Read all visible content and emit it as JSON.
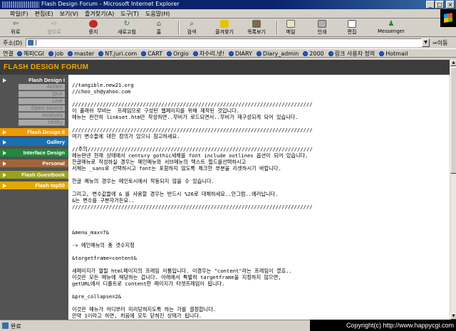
{
  "window": {
    "title": "Flash Design Forum  - Microsoft Internet Explorer",
    "minimize": "_",
    "maximize": "□",
    "close": "×"
  },
  "menu": [
    "파일(F)",
    "편집(E)",
    "보기(V)",
    "즐겨찾기(A)",
    "도구(T)",
    "도움말(H)"
  ],
  "toolbar": {
    "back": "뒤로",
    "forward": "앞으로",
    "stop": "중지",
    "refresh": "새로고침",
    "home": "홈",
    "search": "검색",
    "favorites": "즐겨찾기",
    "history": "목록보기",
    "mail": "메일",
    "print": "인쇄",
    "edit": "편집",
    "messenger": "Messenger"
  },
  "address": {
    "label": "주소(D)",
    "value": "|",
    "go": "이동"
  },
  "links": {
    "label": "연결",
    "items": [
      "해피CGI",
      "job",
      "master",
      "NT.juri.com",
      "CART",
      "Orgio",
      "차수리.넷!",
      "DIARY",
      "Diary_admin",
      "2000",
      "링크 사용자 정의",
      "Hotmail"
    ]
  },
  "site": {
    "logo": "FLASH DESIGN FORUM"
  },
  "sidebar": {
    "design1": "Flash Design I",
    "design1_subs": [
      "Action",
      "QnA",
      "Link",
      "Open source",
      "Analysis",
      "Utility"
    ],
    "design2": "Flash Design II",
    "gallery": "Gallery",
    "interface": "Interface Design",
    "personal": "Personal",
    "guestbook": "Flash Guestbook",
    "top50": "Flash top50"
  },
  "content": {
    "text": "//tangible.new21.org\n//choo_sh@yahoo.com\n\n//////////////////////////////////////////////////////////////////////////////\n이 플래쉬 무비는  프레임으로 구성된 웹페이지를 위해 제작된 것입니다.\n메뉴는 완전히 linkset.htm만 작성하면..무비가 로드되면서..무비가 재구성되게 되어 있습니다.\n\n//////////////////////////////////////////////////////////////////////////////\n여기 변수들에 대한 정의가 있으니 참고하세요.\n\n//주의/////////////////////////////////////////////////////////////////////////\n메뉴판넨 현재 상태에서 century gothic세체를 font include outlines 옵션이 되어 있습니다.\n한글메뉴로 작성하실 경우는 메인메뉴와 서브메뉴의 텍스트 필드를선택하시고\n서체는 _sans로 선택하시고 font는 포함하지 않도록 체크한 부분을 리셋하시기 바랍니다.\n\n한글 메뉴의 경우는 메인토시에서 작동되지 않을 수 있습니다.\n\n그리고, 변수값들에 & 를 사용할 경우는 반드시 %26로 대체하세요..안그럼..에러납니다.\n&는 변수를 구분자거든요..\n//////////////////////////////////////////////////////////////////////////////\n\n\n\n&menu_max=7&\n\n-> 메인메뉴의 총 갯수지정\n\n&targetframe=content&\n\n새페이지가 열릴 html페이지의 프레임 이름입니다. 이경우는 \"content\"라는 프레임이 겠죠..\n이것은 모든 메뉴에 해당하는 겁니다. 아래에서 특별히 targetframe을 지정하지 않으면,\ngetURL에서 디폴트로 content란 페이지가 타겟프레임이 됩니다.\n\n&pre_collapse=2&\n\n이것은 메뉴가 어디부터 미리당혀지도록 하는 가를 결정합니다.\n만약 1이라고 하면, 처음에 모두 닫혀진 상태가 됩니다."
  },
  "status": {
    "text": "완료",
    "copyright": "Copyright(c) http://www.happycgi.com"
  },
  "colors": {
    "titlebar": "#0a246a",
    "logo": "#f0a800",
    "design2": "#f09a00",
    "gallery": "#1a6fb0",
    "interface": "#1f8a3a",
    "personal": "#a0643a",
    "guestbook": "#9aa21a",
    "top50": "#e0a800"
  }
}
